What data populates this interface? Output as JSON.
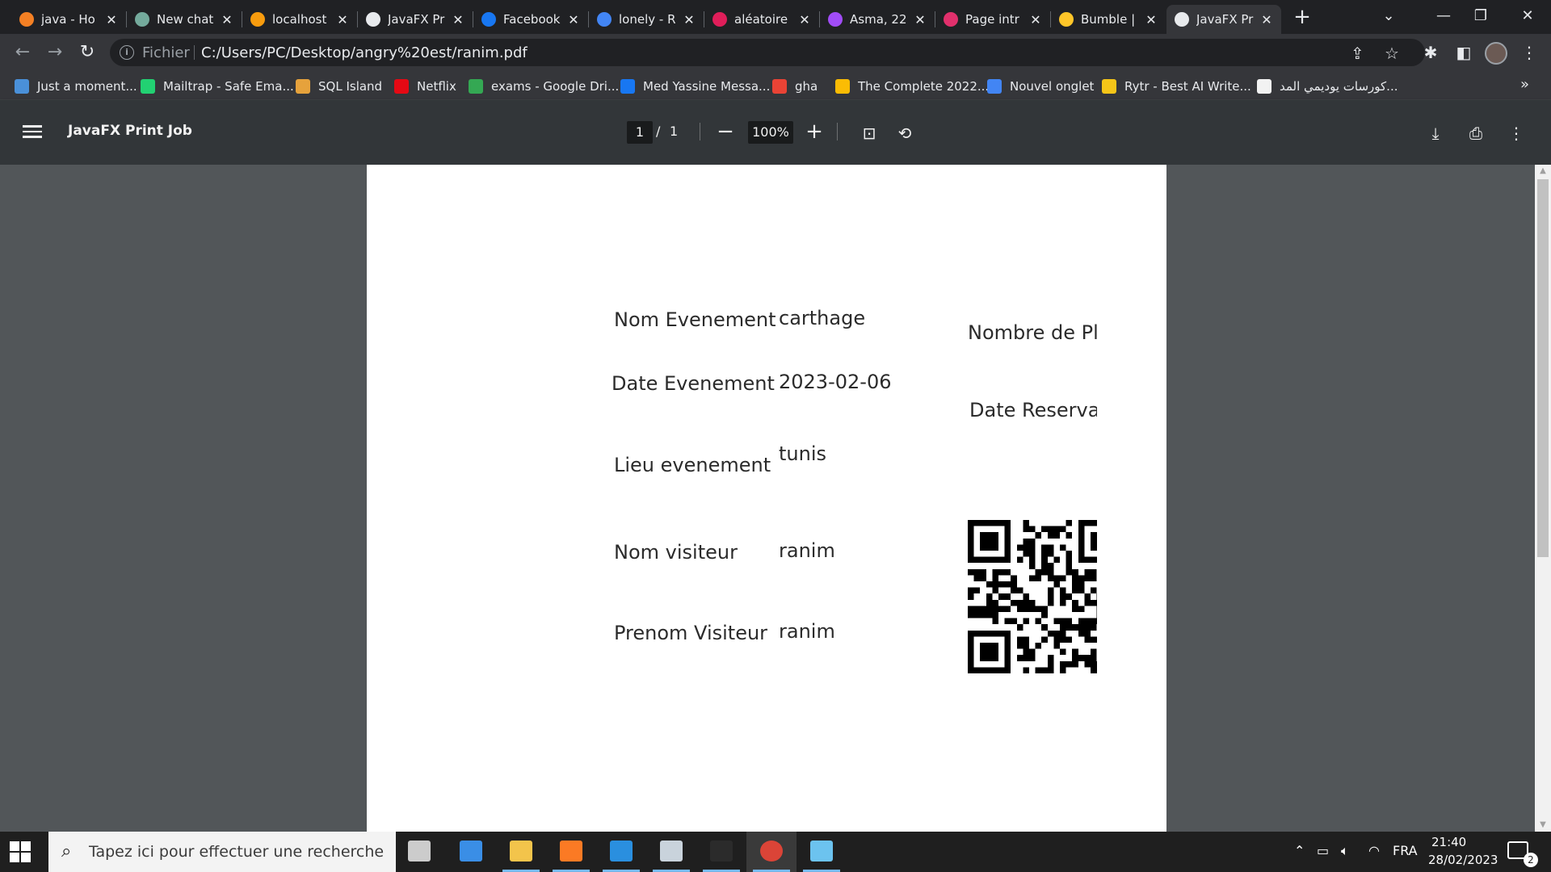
{
  "browser": {
    "tabs": [
      {
        "title": "java - Ho",
        "icon": "stackoverflow-icon",
        "color": "#f48024"
      },
      {
        "title": "New chat",
        "icon": "chatgpt-icon",
        "color": "#74aa9c"
      },
      {
        "title": "localhost",
        "icon": "phpmyadmin-icon",
        "color": "#f89c0e"
      },
      {
        "title": "JavaFX Pr",
        "icon": "globe-icon",
        "color": "#e8eaed"
      },
      {
        "title": "Facebook",
        "icon": "facebook-icon",
        "color": "#1877f2"
      },
      {
        "title": "lonely - R",
        "icon": "google-icon",
        "color": "#4285f4"
      },
      {
        "title": "aléatoire",
        "icon": "slack-icon",
        "color": "#e01e5a"
      },
      {
        "title": "Asma, 22",
        "icon": "dating-icon",
        "color": "#a14cf7"
      },
      {
        "title": "Page intr",
        "icon": "instagram-icon",
        "color": "#e1306c"
      },
      {
        "title": "Bumble |",
        "icon": "bumble-icon",
        "color": "#ffc629"
      },
      {
        "title": "JavaFX Pr",
        "icon": "globe-icon",
        "color": "#e8eaed",
        "active": true
      }
    ],
    "tab_close": "✕",
    "new_tab": "+",
    "address": {
      "scheme": "Fichier",
      "url": "C:/Users/PC/Desktop/angry%20est/ranim.pdf"
    },
    "bookmarks": [
      {
        "label": "Just a moment...",
        "icon": "site-icon",
        "color": "#4a90d9"
      },
      {
        "label": "Mailtrap - Safe Ema...",
        "icon": "mailtrap-icon",
        "color": "#22d172"
      },
      {
        "label": "SQL Island",
        "icon": "island-icon",
        "color": "#e6a23c"
      },
      {
        "label": "Netflix",
        "icon": "netflix-icon",
        "color": "#e50914"
      },
      {
        "label": "exams - Google Dri...",
        "icon": "drive-icon",
        "color": "#34a853"
      },
      {
        "label": "Med Yassine Messa...",
        "icon": "facebook-icon",
        "color": "#1877f2"
      },
      {
        "label": "gha",
        "icon": "gmail-icon",
        "color": "#ea4335"
      },
      {
        "label": "The Complete 2022...",
        "icon": "drive-icon",
        "color": "#fbbc04"
      },
      {
        "label": "Nouvel onglet",
        "icon": "google-icon",
        "color": "#4285f4"
      },
      {
        "label": "Rytr - Best AI Write...",
        "icon": "rytr-icon",
        "color": "#f5c518"
      },
      {
        "label": "كورسات يوديمي المد...",
        "icon": "udemy-icon",
        "color": "#f2f2f2"
      }
    ],
    "bookmarks_more": "»"
  },
  "pdf": {
    "title": "JavaFX Print Job",
    "page_current": "1",
    "page_sep": "/",
    "page_total": "1",
    "zoom": "100%",
    "zoom_out": "−",
    "zoom_in": "+"
  },
  "document": {
    "labels": {
      "nom_evenement": "Nom Evenement",
      "date_evenement": "Date Evenement",
      "lieu_evenement": "Lieu evenement",
      "nom_visiteur": "Nom visiteur",
      "prenom_visiteur": "Prenom Visiteur",
      "nombre_places": "Nombre de Pla",
      "date_reservation": "Date Reservat"
    },
    "values": {
      "nom_evenement": "carthage",
      "date_evenement": "2023-02-06",
      "lieu_evenement": "tunis",
      "nom_visiteur": "ranim",
      "prenom_visiteur": "ranim"
    }
  },
  "taskbar": {
    "search_placeholder": "Tapez ici pour effectuer une recherche",
    "language": "FRA",
    "time": "21:40",
    "date": "28/02/2023",
    "notifications": "2",
    "apps": [
      {
        "icon": "task-view-icon",
        "color": "#cccccc"
      },
      {
        "icon": "news-icon",
        "color": "#3a8ee6"
      },
      {
        "icon": "file-explorer-icon",
        "color": "#f3c44b"
      },
      {
        "icon": "xampp-icon",
        "color": "#fb7a24"
      },
      {
        "icon": "vscode-icon",
        "color": "#2a8fdf"
      },
      {
        "icon": "pinwheel-icon",
        "color": "#c9d3dc"
      },
      {
        "icon": "terminal-icon",
        "color": "#2b2b2b"
      },
      {
        "icon": "chrome-icon",
        "color": "#db4437"
      },
      {
        "icon": "package-icon",
        "color": "#6cc3ef"
      }
    ]
  }
}
